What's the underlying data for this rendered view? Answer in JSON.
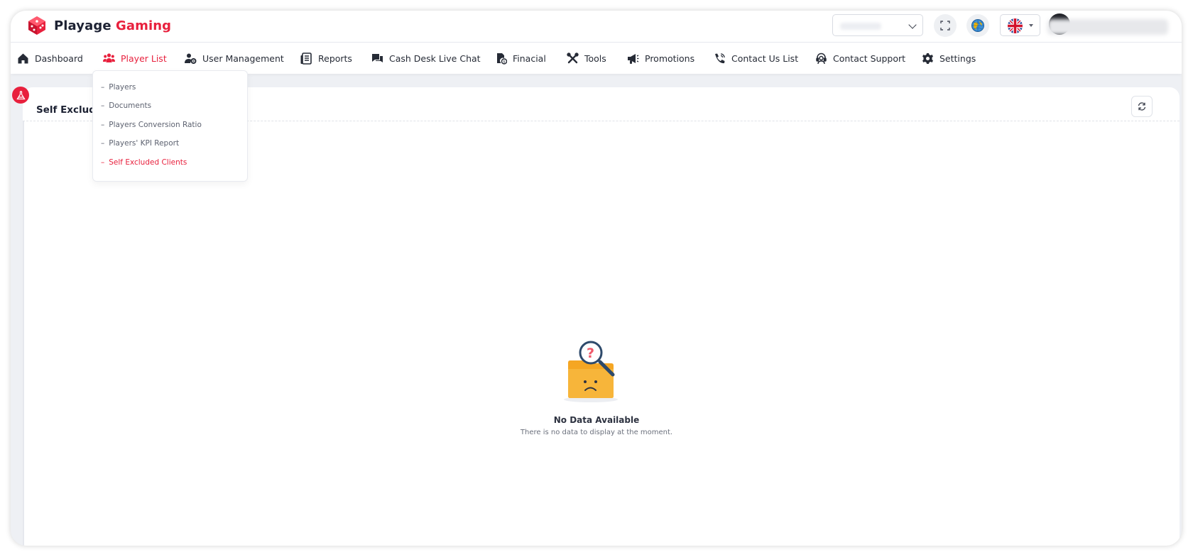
{
  "brand": {
    "name_primary": "Playage",
    "name_accent": "Gaming",
    "accent_color": "#e8203d"
  },
  "header": {
    "icons": [
      "fullscreen-icon",
      "globe-icon"
    ],
    "language_flag": "uk-flag-icon"
  },
  "nav": {
    "items": [
      {
        "label": "Dashboard",
        "icon": "home-icon"
      },
      {
        "label": "Player List",
        "icon": "users-icon",
        "active": true
      },
      {
        "label": "User Management",
        "icon": "user-gear-icon"
      },
      {
        "label": "Reports",
        "icon": "report-icon"
      },
      {
        "label": "Cash Desk Live Chat",
        "icon": "chat-icon"
      },
      {
        "label": "Finacial",
        "icon": "finance-icon"
      },
      {
        "label": "Tools",
        "icon": "tools-icon"
      },
      {
        "label": "Promotions",
        "icon": "megaphone-icon"
      },
      {
        "label": "Contact Us List",
        "icon": "phone-icon"
      },
      {
        "label": "Contact Support",
        "icon": "support-icon"
      },
      {
        "label": "Settings",
        "icon": "gear-icon"
      }
    ]
  },
  "dropdown": {
    "items": [
      {
        "label": "Players"
      },
      {
        "label": "Documents"
      },
      {
        "label": "Players Conversion Ratio"
      },
      {
        "label": "Players' KPI Report"
      },
      {
        "label": "Self Excluded Clients",
        "active": true
      }
    ]
  },
  "page": {
    "title": "Self Exclude"
  },
  "empty_state": {
    "title": "No Data Available",
    "subtitle": "There is no data to display at the moment."
  }
}
